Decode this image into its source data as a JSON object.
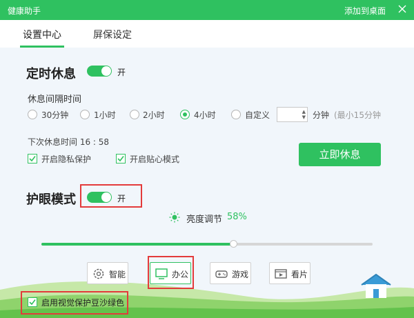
{
  "window": {
    "title": "健康助手",
    "add_to_desktop": "添加到桌面",
    "accent": "#2fc160"
  },
  "tabs": [
    {
      "label": "设置中心",
      "active": true
    },
    {
      "label": "屏保设定",
      "active": false
    }
  ],
  "timed_rest": {
    "title": "定时休息",
    "toggle_text": "开",
    "enabled": true,
    "interval_label": "休息间隔时间",
    "options": [
      {
        "label": "30分钟",
        "checked": false
      },
      {
        "label": "1小时",
        "checked": false
      },
      {
        "label": "2小时",
        "checked": false
      },
      {
        "label": "4小时",
        "checked": true
      },
      {
        "label": "自定义",
        "checked": false
      }
    ],
    "custom_value": "",
    "minute_unit": "分钟",
    "min_hint": "(最小15分钟",
    "next_rest": "下次休息时间 16 : 58",
    "privacy_label": "开启隐私保护",
    "privacy_checked": true,
    "caring_label": "开启贴心模式",
    "caring_checked": true,
    "rest_now": "立即休息"
  },
  "eye_mode": {
    "title": "护眼模式",
    "toggle_text": "开",
    "enabled": true,
    "brightness_label": "亮度调节",
    "brightness_value": "58%",
    "brightness_fraction": 0.58,
    "modes": [
      {
        "label": "智能",
        "icon": "gear-icon",
        "active": false
      },
      {
        "label": "办公",
        "icon": "monitor-icon",
        "active": true
      },
      {
        "label": "游戏",
        "icon": "gamepad-icon",
        "active": false
      },
      {
        "label": "看片",
        "icon": "film-icon",
        "active": false
      }
    ],
    "bean_green_label": "启用视觉保护豆沙绿色",
    "bean_green_checked": true
  }
}
